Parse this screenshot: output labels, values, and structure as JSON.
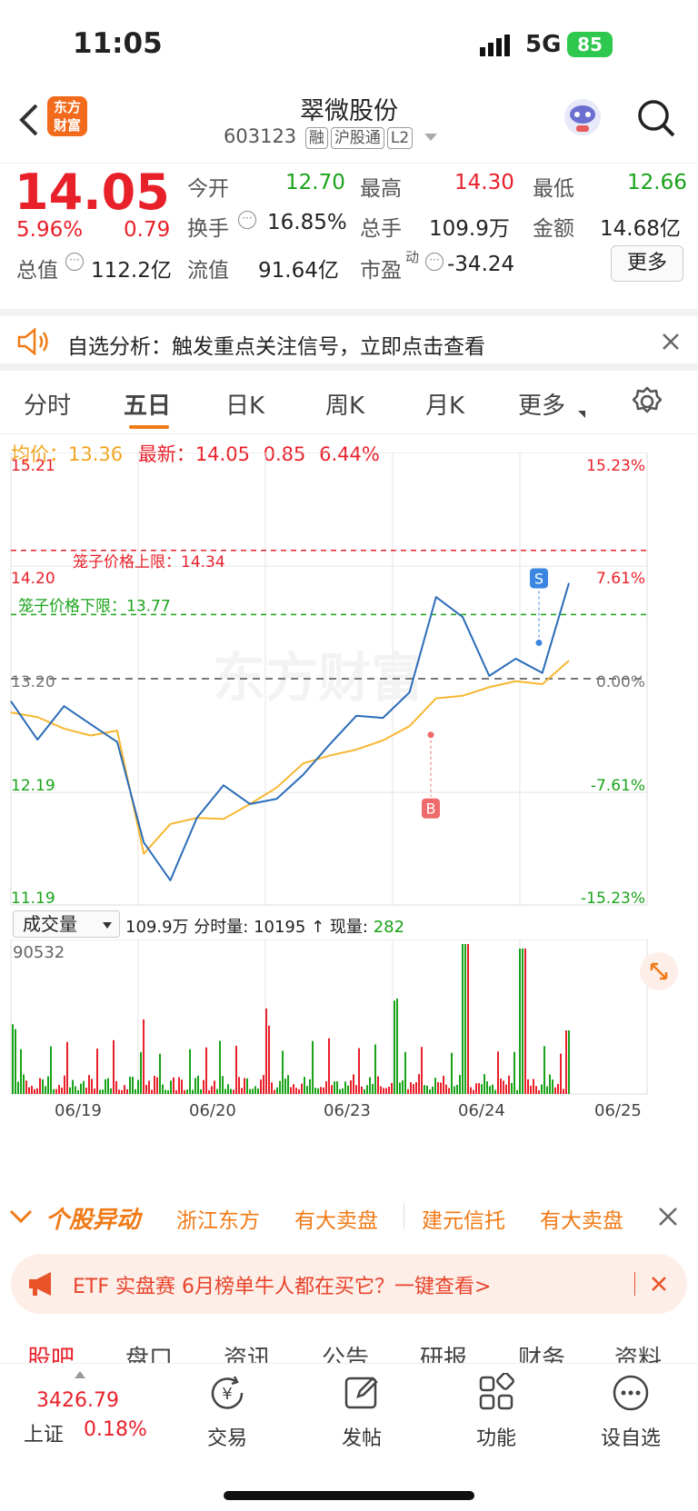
{
  "status": {
    "time": "11:05",
    "network": "5G",
    "battery": "85"
  },
  "header": {
    "stock_name": "翠微股份",
    "code": "603123",
    "tags": [
      "融",
      "沪股通",
      "L2"
    ],
    "logo_line1": "东方",
    "logo_line2": "财富"
  },
  "quote": {
    "price": "14.05",
    "pct": "5.96%",
    "change": "0.79",
    "open_label": "今开",
    "open": "12.70",
    "high_label": "最高",
    "high": "14.30",
    "low_label": "最低",
    "low": "12.66",
    "turnover_label": "换手",
    "turnover": "16.85%",
    "volume_label": "总手",
    "volume": "109.9万",
    "amount_label": "金额",
    "amount": "14.68亿",
    "mcap_label": "总值",
    "mcap": "112.2亿",
    "float_label": "流值",
    "float_cap": "91.64亿",
    "pe_label": "市盈",
    "pe_sup": "动",
    "pe": "-34.24",
    "more": "更多"
  },
  "banner": {
    "text": "自选分析：触发重点关注信号，立即点击查看"
  },
  "ktabs": [
    "分时",
    "五日",
    "日K",
    "周K",
    "月K",
    "更多"
  ],
  "chart": {
    "avg_label": "均价：",
    "avg": "13.36",
    "latest_label": "最新：",
    "latest": "14.05",
    "chg": "0.85",
    "chg_pct": "6.44%",
    "price_ticks": [
      "15.21",
      "14.20",
      "13.20",
      "12.19",
      "11.19"
    ],
    "pct_ticks": [
      "15.23%",
      "7.61%",
      "0.00%",
      "-7.61%",
      "-15.23%"
    ],
    "upper_label": "笼子价格上限：14.34",
    "lower_label": "笼子价格下限：13.77",
    "mark_s": "S",
    "mark_b": "B",
    "watermark": "东方财富",
    "vol_select": "成交量",
    "vol_total": "109.9万",
    "vol_tick_label": "分时量:",
    "vol_tick": "10195",
    "vol_now_label": "现量:",
    "vol_now": "282",
    "vol_max": "90532",
    "dates": [
      "06/19",
      "06/20",
      "06/23",
      "06/24",
      "06/25"
    ]
  },
  "chart_data": {
    "type": "line",
    "title": "",
    "x": [
      "06/19",
      "06/20",
      "06/23",
      "06/24",
      "06/25"
    ],
    "ylim": [
      11.19,
      15.21
    ],
    "prev_close": 13.2,
    "series": [
      {
        "name": "",
        "values": [
          13.0,
          12.7,
          13.0,
          12.8,
          12.6,
          11.7,
          11.4,
          12.0,
          12.3,
          12.1,
          12.1,
          12.3,
          12.6,
          12.9,
          12.9,
          13.1,
          13.9,
          13.7,
          13.2,
          13.4,
          13.3,
          14.05
        ]
      },
      {
        "name": "均价",
        "values": [
          12.9,
          12.9,
          12.8,
          12.7,
          12.7,
          11.6,
          11.9,
          12.0,
          12.0,
          12.1,
          12.2,
          12.4,
          12.5,
          12.6,
          12.7,
          12.8,
          13.0,
          13.0,
          13.1,
          13.2,
          13.2,
          13.36
        ]
      }
    ],
    "upper_limit": 14.34,
    "lower_limit": 13.77
  },
  "movers": {
    "title": "个股异动",
    "items": [
      "浙江东方",
      "有大卖盘",
      "建元信托",
      "有大卖盘"
    ]
  },
  "etf": {
    "text": "ETF 实盘赛 6月榜单牛人都在买它？一键查看>"
  },
  "subtabs": [
    "股吧",
    "盘口",
    "资讯",
    "公告",
    "研报",
    "财务",
    "资料"
  ],
  "bottom": {
    "index_value": "3426.79",
    "index_name": "上证",
    "index_pct": "0.18%",
    "items": [
      "交易",
      "发帖",
      "功能",
      "设自选"
    ]
  }
}
